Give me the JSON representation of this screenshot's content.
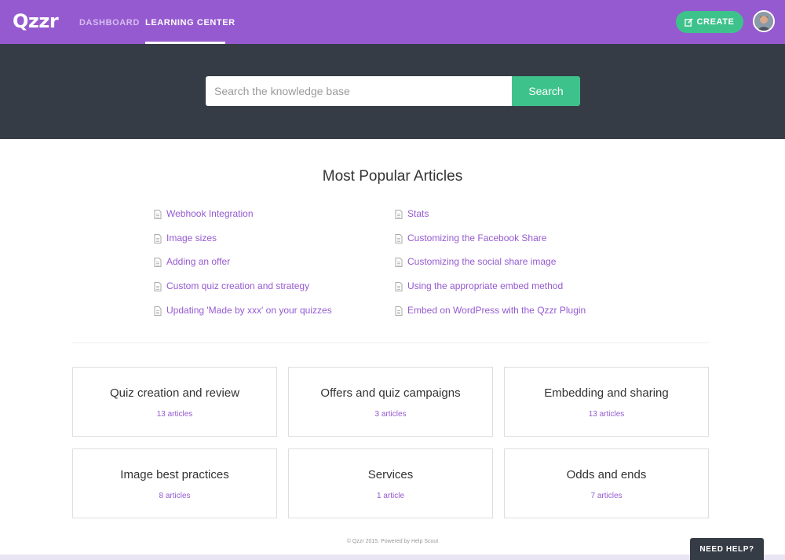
{
  "header": {
    "logo": "Qzzr",
    "nav": [
      {
        "label": "DASHBOARD",
        "active": false
      },
      {
        "label": "LEARNING CENTER",
        "active": true
      }
    ],
    "create_label": "CREATE",
    "create_icon": "edit-icon",
    "avatar_icon": "user-avatar"
  },
  "search": {
    "placeholder": "Search the knowledge base",
    "value": "",
    "button_label": "Search"
  },
  "popular": {
    "title": "Most Popular Articles",
    "article_icon": "document-icon",
    "left": [
      "Webhook Integration",
      "Image sizes",
      "Adding an offer",
      "Custom quiz creation and strategy",
      "Updating 'Made by xxx' on your quizzes"
    ],
    "right": [
      "Stats",
      "Customizing the Facebook Share",
      "Customizing the social share image",
      "Using the appropriate embed method",
      "Embed on WordPress with the Qzzr Plugin"
    ]
  },
  "categories": [
    {
      "title": "Quiz creation and review",
      "count": "13 articles"
    },
    {
      "title": "Offers and quiz campaigns",
      "count": "3 articles"
    },
    {
      "title": "Embedding and sharing",
      "count": "13 articles"
    },
    {
      "title": "Image best practices",
      "count": "8 articles"
    },
    {
      "title": "Services",
      "count": "1 article"
    },
    {
      "title": "Odds and ends",
      "count": "7 articles"
    }
  ],
  "footer": {
    "text": "© Qzzr 2015. Powered by Help Scout",
    "help_label": "NEED HELP?"
  },
  "colors": {
    "brand": "#955ad0",
    "accent": "#3ec28b",
    "dark": "#363c46"
  }
}
